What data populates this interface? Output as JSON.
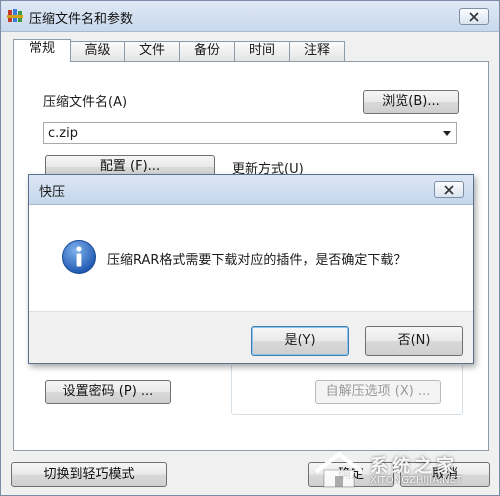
{
  "window": {
    "title": "压缩文件名和参数",
    "tabs": [
      "常规",
      "高级",
      "文件",
      "备份",
      "时间",
      "注释"
    ],
    "active_tab": "常规"
  },
  "general": {
    "archive_name_label": "压缩文件名(A)",
    "browse_button": "浏览(B)...",
    "archive_name_value": "c.zip",
    "config_button": "配置 (F)...",
    "update_mode_label": "更新方式(U)",
    "set_password_button": "设置密码 (P) ...",
    "sfx_options_button": "自解压选项 (X) ..."
  },
  "footer": {
    "switch_mode_button": "切换到轻巧模式",
    "ok_button": "确定",
    "cancel_button": "取消"
  },
  "dialog": {
    "title": "快压",
    "message": "压缩RAR格式需要下载对应的插件，是否确定下载？",
    "yes_button": "是(Y)",
    "no_button": "否(N)"
  },
  "watermark": {
    "text": "系统之家",
    "subtext": "XITONGZHIJIA.NET"
  },
  "colors": {
    "info_icon": "#2f6fc9",
    "titlebar": "#c8d8ec"
  },
  "icons": {
    "app": "winrar-books-icon",
    "close": "close-icon",
    "dialog_info": "info-icon"
  }
}
